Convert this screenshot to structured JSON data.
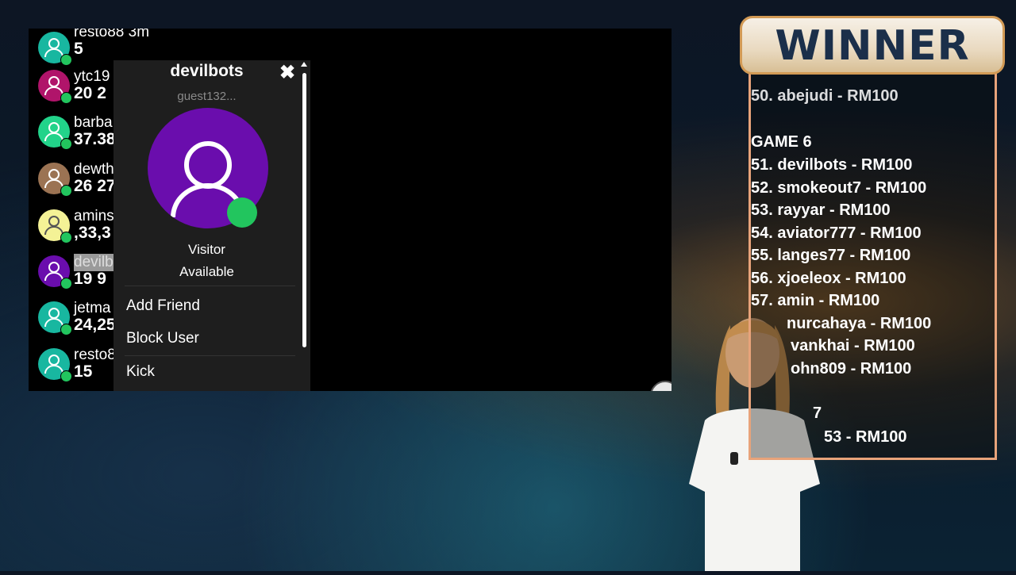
{
  "chat": {
    "users": [
      {
        "name": "resto88 3m",
        "stat": "5",
        "avatar_color": "#18b7a0",
        "selected": false
      },
      {
        "name": "ytc19",
        "stat": "20 2",
        "avatar_color": "#b0146a",
        "selected": false
      },
      {
        "name": "barba",
        "stat": "37.38",
        "avatar_color": "#22d38a",
        "selected": false
      },
      {
        "name": "dewth",
        "stat": "26 27",
        "avatar_color": "#9b7353",
        "selected": false
      },
      {
        "name": "amins",
        "stat": ",33,3",
        "avatar_color": "#f4f296",
        "selected": false
      },
      {
        "name": "devilb",
        "stat": "19 9",
        "avatar_color": "#6a0dad",
        "selected": true
      },
      {
        "name": "jetma",
        "stat": "24,25",
        "avatar_color": "#18b7a0",
        "selected": false
      },
      {
        "name": "resto8",
        "stat": "15",
        "avatar_color": "#18b7a0",
        "selected": false
      }
    ]
  },
  "popup": {
    "name": "devilbots",
    "guest": "guest132...",
    "role": "Visitor",
    "status": "Available",
    "menu": [
      "Add Friend",
      "Block User",
      "Kick"
    ],
    "close_icon": "✖",
    "avatar_color": "#6a0dad",
    "online_color": "#22c55e"
  },
  "winner": {
    "title": "WINNER",
    "lines": [
      "50. abejudi - RM100",
      "",
      "GAME 6",
      "51. devilbots - RM100",
      "52. smokeout7 - RM100",
      "53. rayyar - RM100",
      "54. aviator777 - RM100",
      "55. langes77 - RM100",
      "56. xjoeleox - RM100",
      "57. amin - RM100",
      "nurcahaya - RM100",
      "vankhai - RM100",
      "ohn809 - RM100",
      "",
      "7",
      "53 - RM100"
    ]
  },
  "scroll_down_icon": "chevron-down-icon"
}
